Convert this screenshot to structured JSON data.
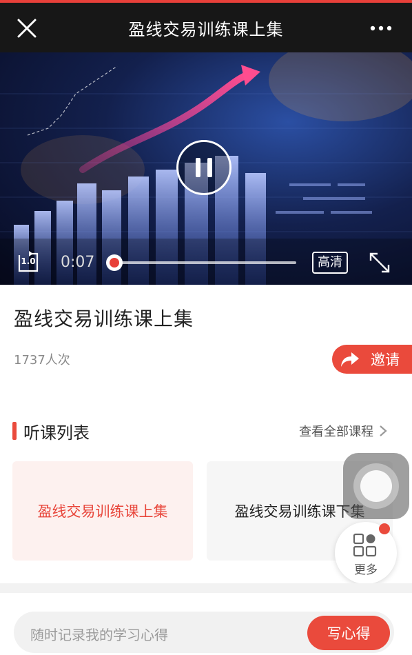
{
  "header": {
    "title": "盈线交易训练课上集",
    "close_icon": "close-icon",
    "more_icon": "more-dots-icon"
  },
  "player": {
    "speed_label": "1.0",
    "current_time": "0:07",
    "quality_label": "高清",
    "progress": 0.0,
    "icons": [
      "pause-icon",
      "speed-icon",
      "fullscreen-icon"
    ]
  },
  "course": {
    "title": "盈线交易训练课上集",
    "views": "1737人次",
    "invite_label": "邀请"
  },
  "list": {
    "header": "听课列表",
    "view_all": "查看全部课程",
    "lessons": [
      {
        "title": "盈线交易训练课上集",
        "active": true
      },
      {
        "title": "盈线交易训练课下集",
        "active": false
      }
    ]
  },
  "more_menu": {
    "label": "更多"
  },
  "note": {
    "placeholder": "随时记录我的学习心得",
    "button": "写心得"
  },
  "colors": {
    "accent": "#ea4a3c",
    "titlebar": "#171717",
    "active_card_bg": "#fdf1ef"
  }
}
